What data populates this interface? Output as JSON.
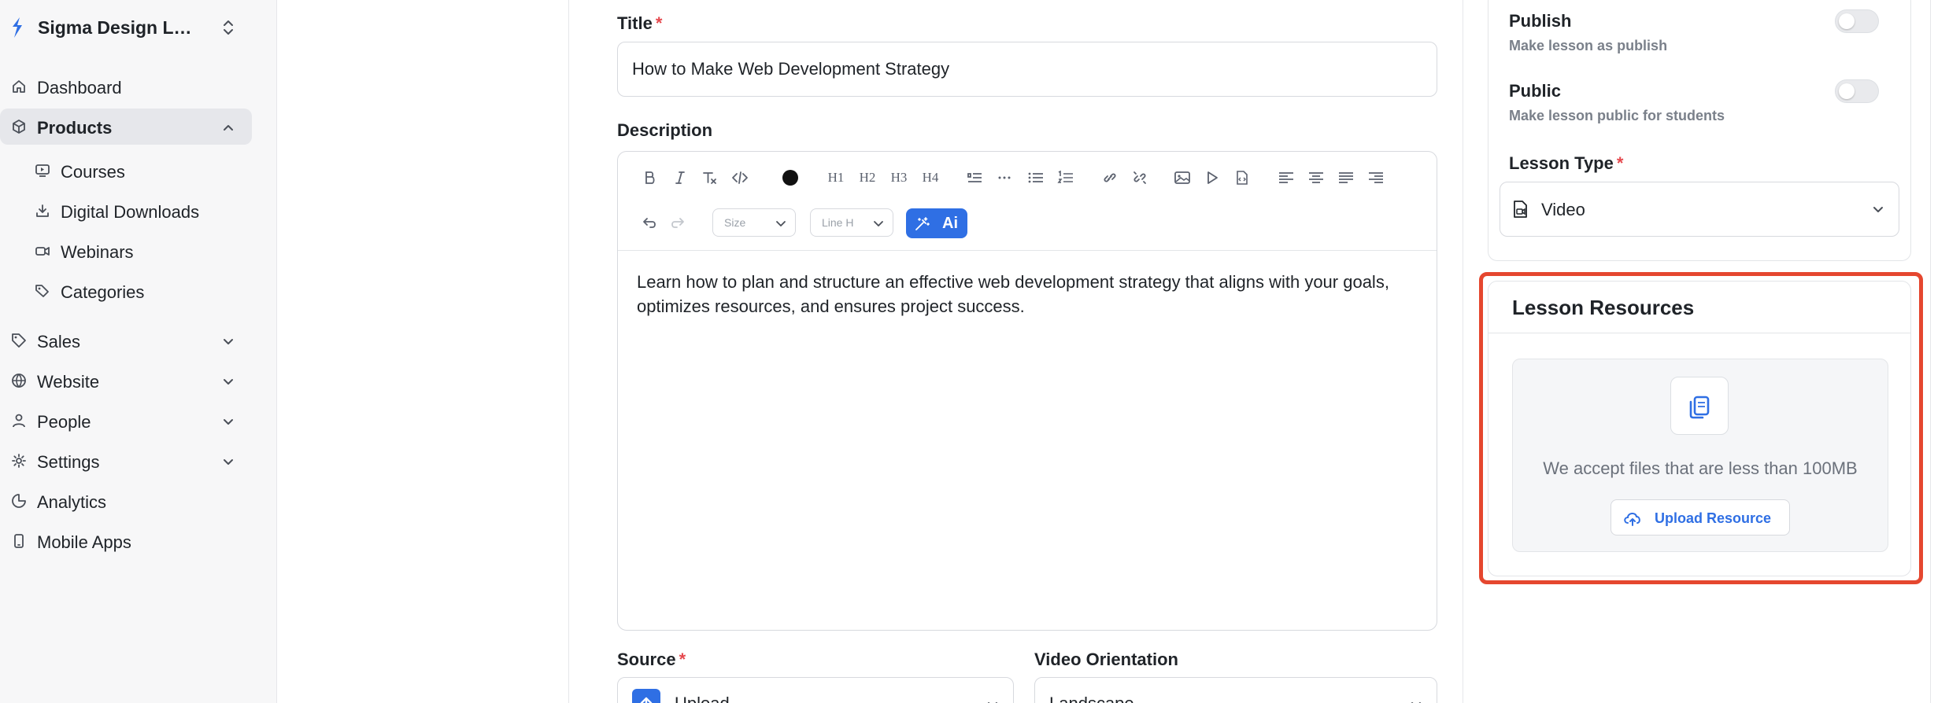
{
  "sidebar": {
    "brand": "Sigma Design La...",
    "items": [
      {
        "label": "Dashboard"
      },
      {
        "label": "Products"
      },
      {
        "label": "Courses"
      },
      {
        "label": "Digital Downloads"
      },
      {
        "label": "Webinars"
      },
      {
        "label": "Categories"
      },
      {
        "label": "Sales"
      },
      {
        "label": "Website"
      },
      {
        "label": "People"
      },
      {
        "label": "Settings"
      },
      {
        "label": "Analytics"
      },
      {
        "label": "Mobile Apps"
      }
    ]
  },
  "form": {
    "title_label": "Title",
    "required_mark": "*",
    "title_value": "How to Make Web Development Strategy",
    "description_label": "Description",
    "description_value": "Learn how to plan and structure an effective web development strategy that aligns with your goals, optimizes resources, and ensures project success.",
    "toolbar": {
      "h1": "H1",
      "h2": "H2",
      "h3": "H3",
      "h4": "H4",
      "size_placeholder": "Size",
      "line_height_placeholder": "Line H",
      "ai_label": "Ai"
    },
    "source_label": "Source",
    "source_value": "Upload",
    "orientation_label": "Video Orientation",
    "orientation_value": "Landscape"
  },
  "settings": {
    "publish_title": "Publish",
    "publish_desc": "Make lesson as publish",
    "public_title": "Public",
    "public_desc": "Make lesson public for students",
    "lesson_type_label": "Lesson Type",
    "lesson_type_value": "Video"
  },
  "resources": {
    "title": "Lesson Resources",
    "hint": "We accept files that are less than 100MB",
    "upload_label": "Upload Resource"
  },
  "colors": {
    "accent": "#2f6fe4",
    "highlight": "#e5472f",
    "required": "#e5484d"
  }
}
